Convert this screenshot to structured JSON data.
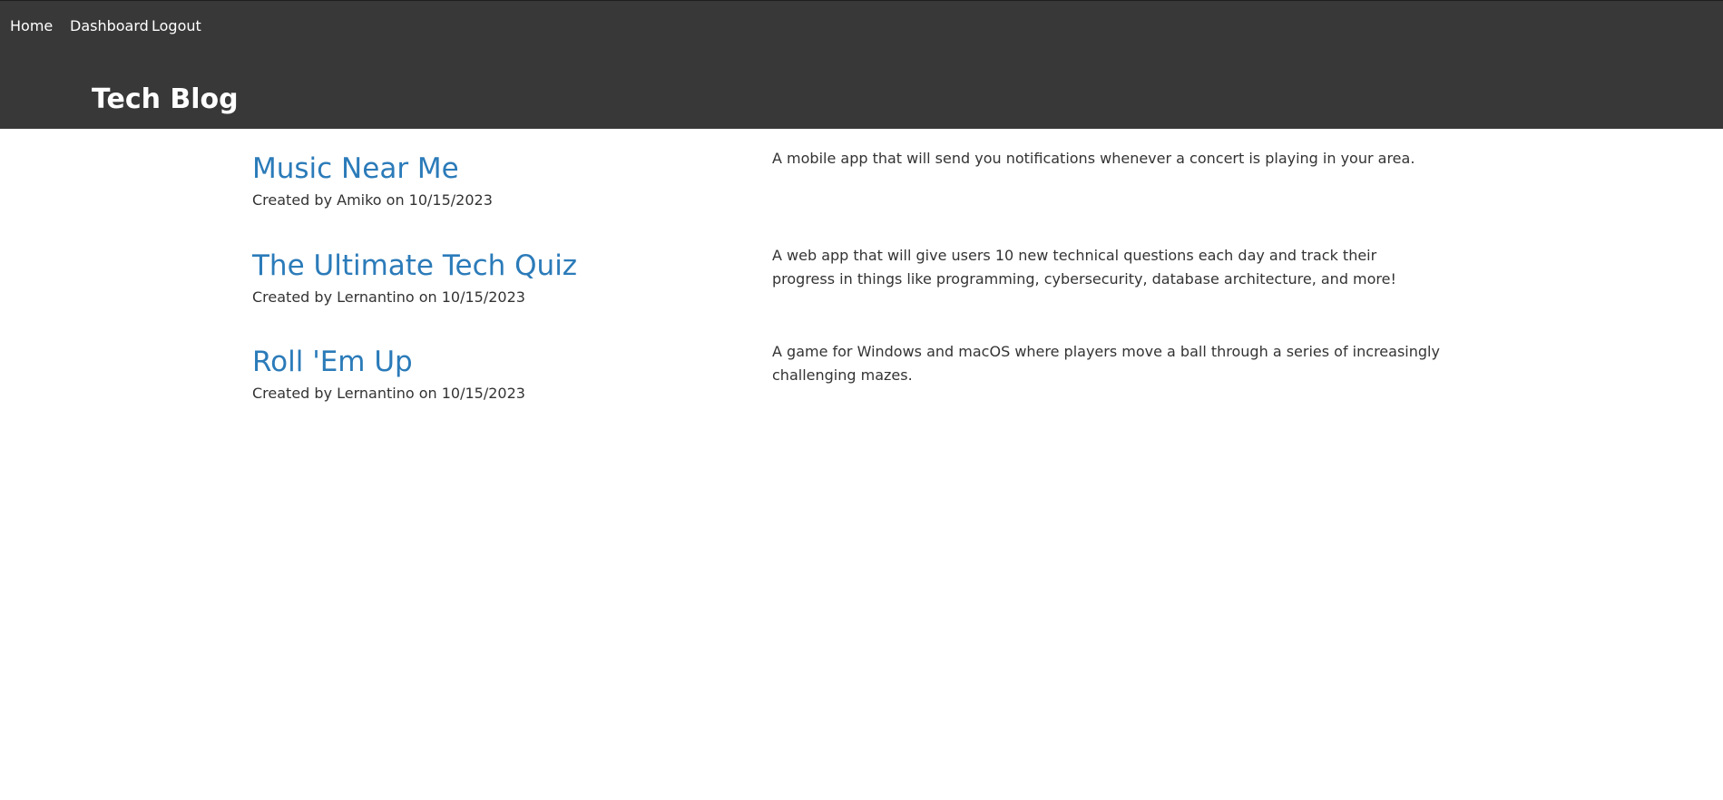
{
  "nav": {
    "home": "Home",
    "dashboard": "Dashboard",
    "logout": "Logout"
  },
  "site": {
    "title": "Tech Blog"
  },
  "posts": [
    {
      "title": "Music Near Me",
      "meta": "Created by Amiko on 10/15/2023",
      "description": "A mobile app that will send you notifications whenever a concert is playing in your area."
    },
    {
      "title": "The Ultimate Tech Quiz",
      "meta": "Created by Lernantino on 10/15/2023",
      "description": "A web app that will give users 10 new technical questions each day and track their progress in things like programming, cybersecurity, database architecture, and more!"
    },
    {
      "title": "Roll 'Em Up",
      "meta": "Created by Lernantino on 10/15/2023",
      "description": "A game for Windows and macOS where players move a ball through a series of increasingly challenging mazes."
    }
  ],
  "colors": {
    "header_bg": "#383838",
    "link_blue": "#2b7bb9",
    "text": "#333333"
  }
}
